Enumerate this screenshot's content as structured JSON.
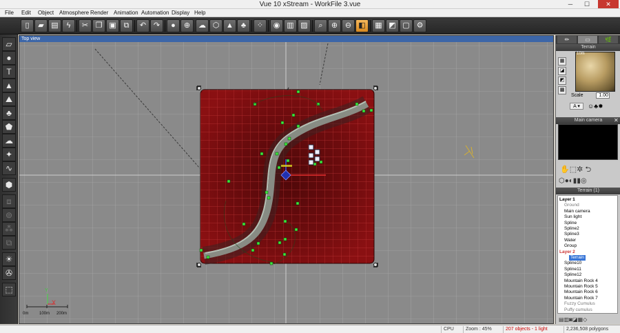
{
  "window": {
    "title": "Vue 10 xStream - WorkFile 3.vue",
    "minimize": "─",
    "maximize": "☐",
    "close": "✕"
  },
  "menu": [
    "File",
    "Edit",
    "Object",
    "Atmosphere",
    "Render",
    "Animation",
    "Automation",
    "Display",
    "Help"
  ],
  "toolbar": {
    "icons": [
      "new-file-icon",
      "open-file-icon",
      "save-icon",
      "render-lightning-icon",
      "cut-icon",
      "copy-icon",
      "paste-icon",
      "duplicate-icon",
      "undo-icon",
      "redo-icon",
      "add-object-icon",
      "camera-center-icon",
      "atmosphere-icon",
      "object-library-icon",
      "terrain-icon",
      "plant-icon",
      "material-icon",
      "color-balls-icon",
      "render-icon",
      "stats-icon",
      "sculpt-icon",
      "zoom-to-fit-icon",
      "zoom-in-icon",
      "zoom-out-icon",
      "pan-icon",
      "view-active-icon",
      "film-icon",
      "clapper-icon",
      "single-view-icon",
      "settings-icon"
    ]
  },
  "left_toolbar": {
    "icons": [
      "cursor-icon",
      "sphere-icon",
      "text-icon",
      "terrain-icon",
      "mountain-icon",
      "plant-icon",
      "rock-icon",
      "cloud-icon",
      "light-icon",
      "curve-icon",
      "cube-icon",
      "group-icon",
      "boolean-icon",
      "metablob-icon",
      "link-icon",
      "sun-icon",
      "wind-icon",
      "navigate-icon"
    ]
  },
  "viewport": {
    "title": "Top view",
    "scale": {
      "labels": [
        "0m",
        "100m",
        "200m"
      ]
    },
    "axis": {
      "x": "X",
      "y": "Y"
    }
  },
  "right_panel": {
    "tabs": [
      "✏",
      "▭",
      "🌿"
    ],
    "material_header": "Terrain",
    "material_name": "10m",
    "scale_label": "Scale",
    "scale_value": "1.00",
    "camera_header": "Main camera",
    "tree_header": "Terrain (1)",
    "tree": [
      {
        "label": "Layer 1",
        "indent": 0,
        "style": "layer"
      },
      {
        "label": "Ground",
        "indent": 1,
        "style": "grey"
      },
      {
        "label": "Main camera",
        "indent": 1,
        "style": ""
      },
      {
        "label": "Sun light",
        "indent": 1,
        "style": ""
      },
      {
        "label": "Spline",
        "indent": 1,
        "style": ""
      },
      {
        "label": "Spline2",
        "indent": 1,
        "style": ""
      },
      {
        "label": "Spline3",
        "indent": 1,
        "style": ""
      },
      {
        "label": "Water",
        "indent": 1,
        "style": ""
      },
      {
        "label": "Group",
        "indent": 1,
        "style": ""
      },
      {
        "label": "Layer 2",
        "indent": 0,
        "style": "layer red"
      },
      {
        "label": "Terrain",
        "indent": 2,
        "style": "selected"
      },
      {
        "label": "Spline10",
        "indent": 1,
        "style": ""
      },
      {
        "label": "Spline11",
        "indent": 1,
        "style": ""
      },
      {
        "label": "Spline12",
        "indent": 1,
        "style": ""
      },
      {
        "label": "Mountain Rock 4",
        "indent": 1,
        "style": ""
      },
      {
        "label": "Mountain Rock 5",
        "indent": 1,
        "style": ""
      },
      {
        "label": "Mountain Rock 6",
        "indent": 1,
        "style": ""
      },
      {
        "label": "Mountain Rock 7",
        "indent": 1,
        "style": ""
      },
      {
        "label": "Fuzzy Cumulus",
        "indent": 1,
        "style": "grey"
      },
      {
        "label": "Puffy cumulus",
        "indent": 1,
        "style": "grey"
      }
    ]
  },
  "status": {
    "cpu": "CPU",
    "zoom": "Zoom : 45%",
    "objects": "207 objects - 1 light",
    "polygons": "2,236,508 polygons"
  },
  "colors": {
    "accent": "#3c66a8",
    "terrain": "#7a0e10",
    "grid": "#a6a6a6"
  }
}
